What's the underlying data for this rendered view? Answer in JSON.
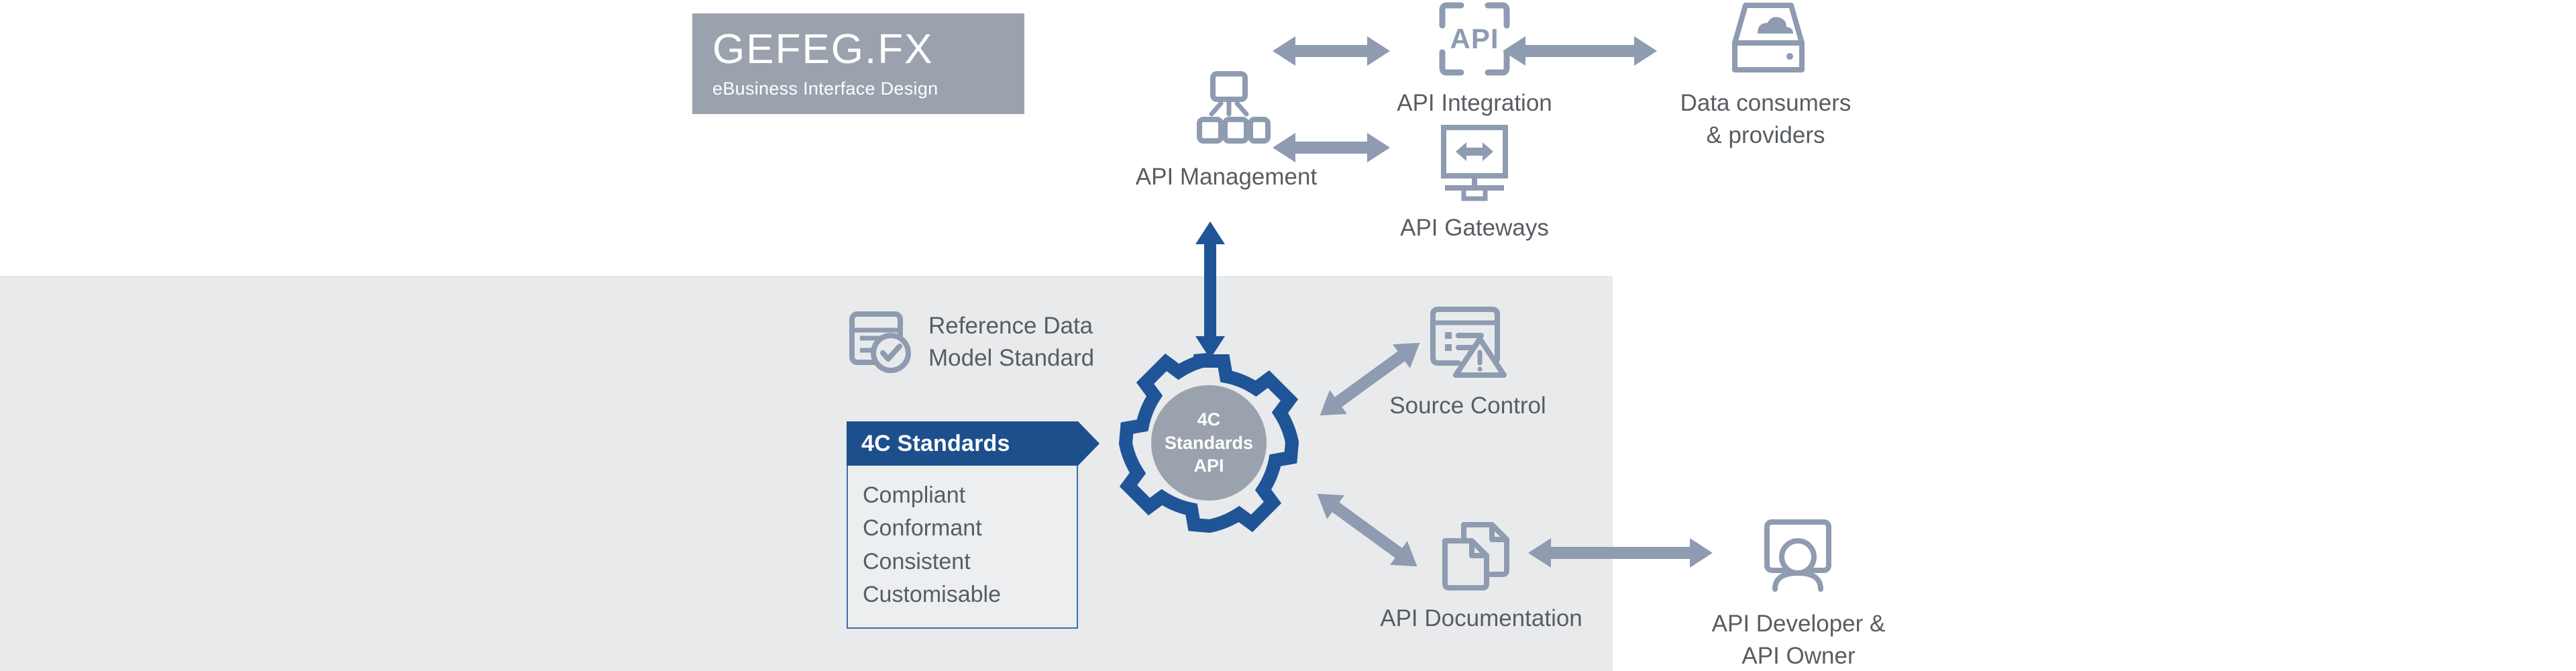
{
  "colors": {
    "brand_blue": "#1d4f8c",
    "gear_blue": "#1f5597",
    "arrow_grey": "#8e9bb0",
    "icon_grey": "#8e9bb0",
    "panel_grey": "#e8eaec",
    "logo_grey": "#9aa2ad",
    "label_text": "#585d62"
  },
  "logo": {
    "name": "gefeg-fx-logo",
    "main": "GEFEG.FX",
    "subtitle": "eBusiness Interface Design"
  },
  "nodes": {
    "api_management": {
      "label": "API Management",
      "icon": "network-hierarchy-icon"
    },
    "api_integration": {
      "label": "API Integration",
      "icon": "api-brackets-icon",
      "icon_text": "API"
    },
    "api_gateways": {
      "label": "API Gateways",
      "icon": "gateway-monitor-icon"
    },
    "data_consumers": {
      "label": "Data consumers\n& providers",
      "icon": "cloud-drive-icon"
    },
    "reference_data_model": {
      "label": "Reference Data\nModel Standard",
      "icon": "data-model-check-icon"
    },
    "source_control": {
      "label": "Source Control",
      "icon": "source-control-warning-icon"
    },
    "api_documentation": {
      "label": "API Documentation",
      "icon": "documents-icon"
    },
    "api_developer_owner": {
      "label": "API Developer &\nAPI Owner",
      "icon": "developer-person-screen-icon"
    }
  },
  "center": {
    "name": "4c-standards-api-gear",
    "lines": [
      "4C",
      "Standards",
      "API"
    ],
    "text": "4C Standards API"
  },
  "standards_box": {
    "title": "4C Standards",
    "items": [
      "Compliant",
      "Conformant",
      "Consistent",
      "Customisable"
    ]
  },
  "connectors": [
    {
      "name": "arrow-management-integration",
      "type": "double",
      "color": "#8e9bb0"
    },
    {
      "name": "arrow-integration-consumers",
      "type": "double",
      "color": "#8e9bb0"
    },
    {
      "name": "arrow-management-gateways",
      "type": "double",
      "color": "#8e9bb0"
    },
    {
      "name": "arrow-gear-management",
      "type": "double-vertical",
      "color": "#1f5597"
    },
    {
      "name": "arrow-gear-source-control",
      "type": "double-diagonal",
      "color": "#8e9bb0"
    },
    {
      "name": "arrow-gear-documentation",
      "type": "double-diagonal",
      "color": "#8e9bb0"
    },
    {
      "name": "arrow-documentation-developer",
      "type": "double",
      "color": "#8e9bb0"
    }
  ]
}
